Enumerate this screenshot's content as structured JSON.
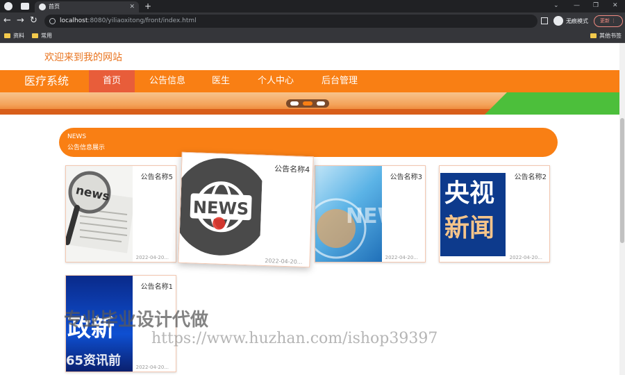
{
  "browser": {
    "tab_title": "首页",
    "url_host": "localhost",
    "url_path": ":8080/yiliaoxitong/front/index.html",
    "bookmarks": [
      "资料",
      "常用"
    ],
    "other_bookmarks": "其他书签",
    "profile_label": "无痕模式",
    "update_label": "更新"
  },
  "site": {
    "welcome": "欢迎来到我的网站",
    "logo": "医疗系统",
    "nav": [
      "首页",
      "公告信息",
      "医生",
      "个人中心",
      "后台管理"
    ],
    "active_nav": 0
  },
  "section": {
    "title": "NEWS",
    "subtitle": "公告信息展示"
  },
  "cards": [
    {
      "name": "公告名称5",
      "date": "2022-04-20..."
    },
    {
      "name": "公告名称4",
      "date": "2022-04-20..."
    },
    {
      "name": "公告名称3",
      "date": "2022-04-20..."
    },
    {
      "name": "公告名称2",
      "date": "2022-04-20..."
    },
    {
      "name": "公告名称1",
      "date": "2022-04-20..."
    }
  ],
  "thumb_text": {
    "news": "news",
    "news_globe": "NEWS",
    "news_blue": "NEW",
    "cctv_line1": "央视",
    "cctv_line2": "新闻",
    "gov_news": "政新",
    "gov_sub": "65资讯前"
  },
  "watermark": {
    "cn": "专业毕业设计代做",
    "url": "https://www.huzhan.com/ishop39397"
  },
  "colors": {
    "accent": "#f97f14",
    "nav_active": "#e85d3a",
    "welcome_text": "#e9731d"
  }
}
